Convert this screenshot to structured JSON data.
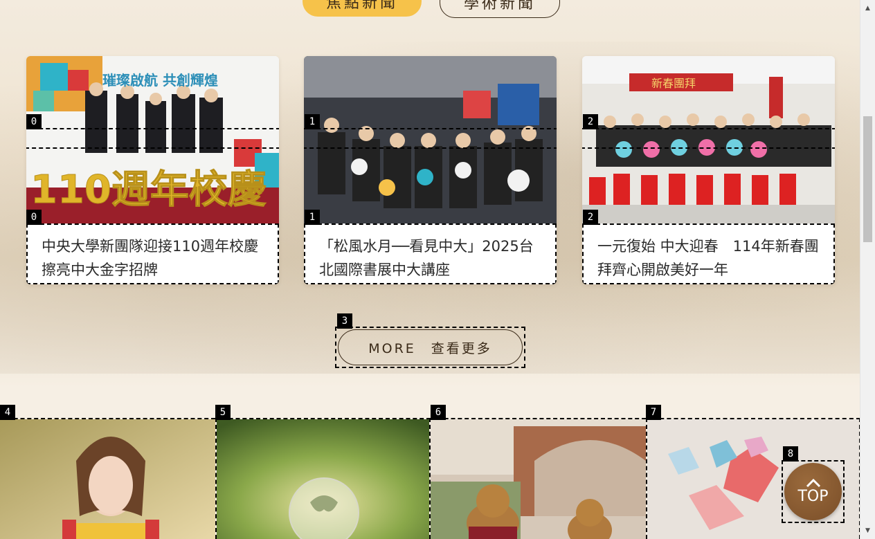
{
  "tabs": [
    {
      "label": "焦點新聞",
      "active": true
    },
    {
      "label": "學術新聞",
      "active": false
    }
  ],
  "news_cards": [
    {
      "index": "0",
      "title": "中央大學新團隊迎接110週年校慶　擦亮中大金字招牌",
      "photo_text_banner": "璀璨啟航 共創輝煌",
      "photo_text_big": "110週年校慶"
    },
    {
      "index": "1",
      "title": "「松風水月──看見中大」2025台北國際書展中大講座"
    },
    {
      "index": "2",
      "title": "一元復始 中大迎春　114年新春團拜齊心開啟美好一年",
      "photo_text_banner": "新春團拜"
    }
  ],
  "more_button": {
    "index": "3",
    "label": "MORE　查看更多"
  },
  "tiles": [
    {
      "index": "4"
    },
    {
      "index": "5"
    },
    {
      "index": "6"
    },
    {
      "index": "7"
    }
  ],
  "top_button": {
    "index": "8",
    "label": "TOP"
  },
  "colors": {
    "accent": "#f6c24a",
    "brown": "#7a4e28",
    "text": "#3a2a18"
  }
}
